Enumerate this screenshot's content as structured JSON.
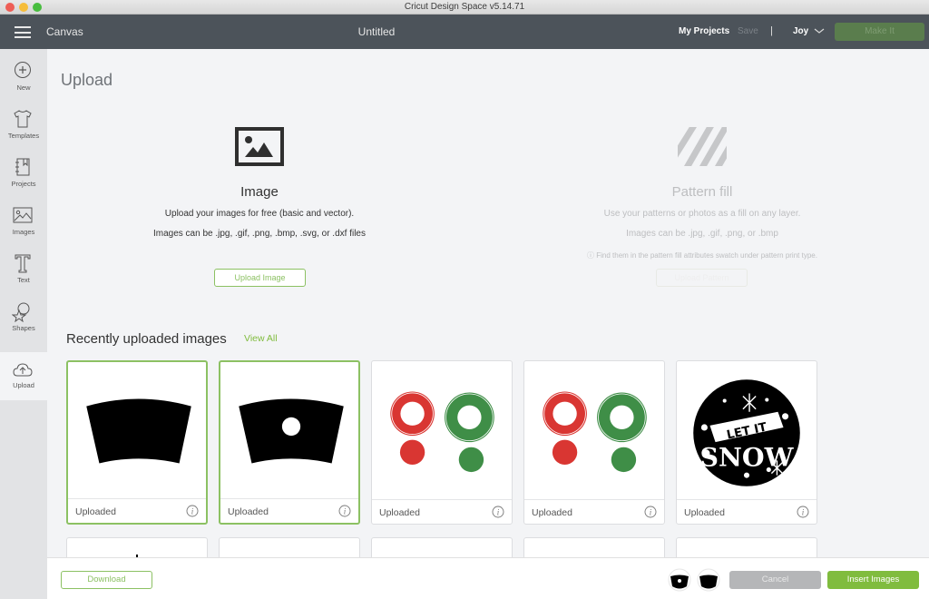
{
  "window": {
    "title": "Cricut Design Space  v5.14.71"
  },
  "appbar": {
    "menu_icon": "hamburger-icon",
    "canvas_label": "Canvas",
    "document_title": "Untitled",
    "my_projects": "My Projects",
    "save": "Save",
    "separator": "|",
    "user": "Joy",
    "make_it": "Make It"
  },
  "sidebar": {
    "items": [
      {
        "label": "New",
        "icon": "plus-circle-icon"
      },
      {
        "label": "Templates",
        "icon": "tshirt-icon"
      },
      {
        "label": "Projects",
        "icon": "notebook-icon"
      },
      {
        "label": "Images",
        "icon": "image-icon"
      },
      {
        "label": "Text",
        "icon": "text-icon"
      },
      {
        "label": "Shapes",
        "icon": "shapes-icon"
      },
      {
        "label": "Upload",
        "icon": "cloud-upload-icon",
        "active": true
      }
    ]
  },
  "page": {
    "title": "Upload"
  },
  "image_section": {
    "title": "Image",
    "line1": "Upload your images for free (basic and vector).",
    "line2": "Images can be .jpg, .gif, .png, .bmp, .svg, or .dxf files",
    "button": "Upload Image"
  },
  "pattern_section": {
    "title": "Pattern fill",
    "line1": "Use your patterns or photos as a fill on any layer.",
    "line2": "Images can be .jpg, .gif, .png, or .bmp",
    "note": "ⓘ Find them in the pattern fill attributes swatch under pattern print type.",
    "button": "Upload Pattern"
  },
  "recent": {
    "title": "Recently uploaded images",
    "view_all": "View All",
    "cards": [
      {
        "caption": "Uploaded",
        "thumb": "tumbler-wrap",
        "selected": true
      },
      {
        "caption": "Uploaded",
        "thumb": "tumbler-wrap-hole",
        "selected": true
      },
      {
        "caption": "Uploaded",
        "thumb": "red-green-rings",
        "selected": false
      },
      {
        "caption": "Uploaded",
        "thumb": "red-green-rings",
        "selected": false
      },
      {
        "caption": "Uploaded",
        "thumb": "let-it-snow",
        "selected": false
      }
    ],
    "snow_text_top": "LET IT",
    "snow_text_bottom": "SNOW"
  },
  "colors": {
    "accent_green": "#80bc3e",
    "ring_red": "#d93632",
    "ring_green": "#3f8e47"
  },
  "footer": {
    "download": "Download",
    "cancel": "Cancel",
    "insert": "Insert Images"
  }
}
